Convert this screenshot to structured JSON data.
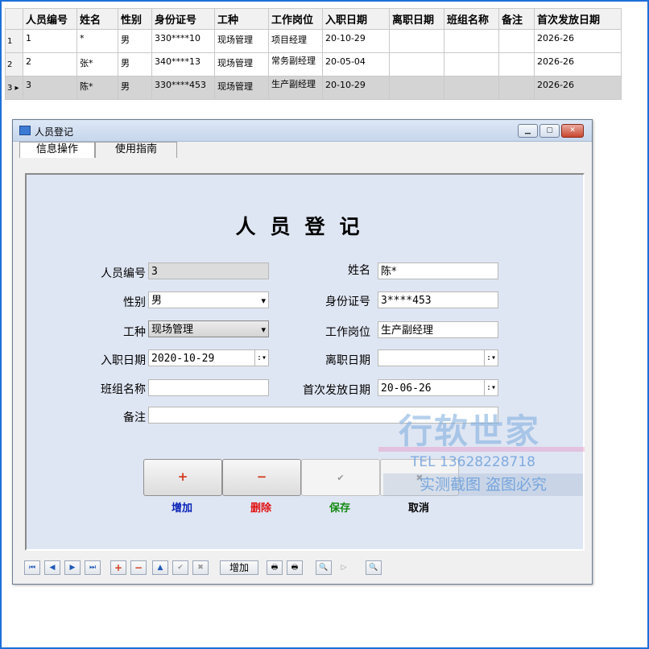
{
  "grid": {
    "columns": [
      "人员编号",
      "姓名",
      "性别",
      "身份证号",
      "工种",
      "工作岗位",
      "入职日期",
      "离职日期",
      "班组名称",
      "备注",
      "首次发放日期"
    ],
    "rows": [
      {
        "rn": "1",
        "cells": [
          "1",
          "*",
          "男",
          "330****10",
          "现场管理",
          "项目经理",
          "20-10-29",
          "",
          "",
          "",
          "2026-26"
        ]
      },
      {
        "rn": "2",
        "cells": [
          "2",
          "张*",
          "男",
          "340****13",
          "现场管理",
          "常务副经理",
          "20-05-04",
          "",
          "",
          "",
          "2026-26"
        ]
      },
      {
        "rn": "3 ▸",
        "cells": [
          "3",
          "陈*",
          "男",
          "330****453",
          "现场管理",
          "生产副经理",
          "20-10-29",
          "",
          "",
          "",
          "2026-26"
        ]
      }
    ]
  },
  "window": {
    "title": "人员登记",
    "tabs": [
      "信息操作",
      "使用指南"
    ],
    "form_title": "人员登记",
    "fields": {
      "emp_no_label": "人员编号",
      "emp_no": "3",
      "name_label": "姓名",
      "name": "陈*",
      "gender_label": "性别",
      "gender": "男",
      "id_label": "身份证号",
      "id_no": "3****453",
      "worktype_label": "工种",
      "worktype": "现场管理",
      "position_label": "工作岗位",
      "position": "生产副经理",
      "hire_label": "入职日期",
      "hire_date": "2020-10-29",
      "leave_label": "离职日期",
      "leave_date": "",
      "team_label": "班组名称",
      "team": "",
      "firstpay_label": "首次发放日期",
      "firstpay_date": "20-06-26",
      "note_label": "备注",
      "note": ""
    },
    "buttons": {
      "add_icon": "+",
      "add_label": "增加",
      "add_color": "#0a23b8",
      "delete_icon": "−",
      "delete_label": "删除",
      "delete_color": "#e01010",
      "save_icon": "✔",
      "save_label": "保存",
      "save_color": "#128a12",
      "cancel_icon": "✖",
      "cancel_label": "取消",
      "cancel_color": "#000000"
    },
    "navbar": {
      "add_label": "增加"
    }
  },
  "watermark": {
    "brand": "行软世家",
    "tel": "TEL   13628228718",
    "notice": "实测截图  盗图必究"
  }
}
